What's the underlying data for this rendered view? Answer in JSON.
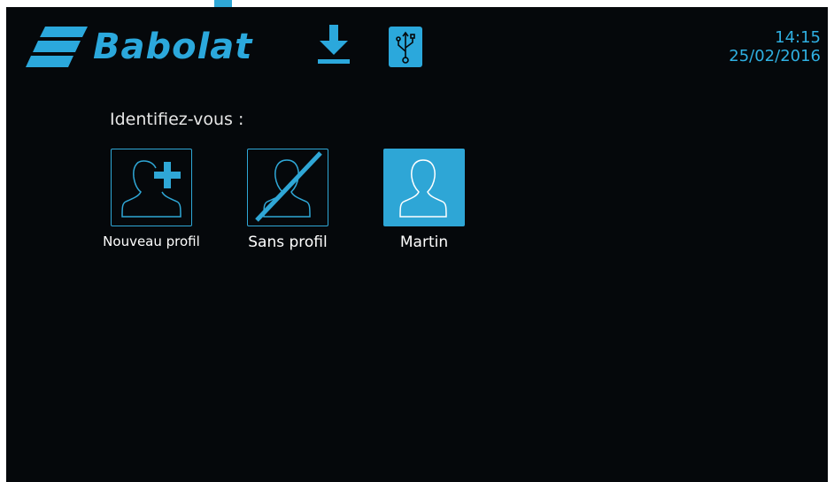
{
  "header": {
    "brand_name": "Babolat",
    "logo_icon": "babolat-stripes-logo",
    "download_icon": "download-icon",
    "usb_icon": "usb-icon",
    "accent_color": "#2ba8dc"
  },
  "clock": {
    "time": "14:15",
    "date": "25/02/2016"
  },
  "main": {
    "prompt": "Identifiez-vous :",
    "profiles": [
      {
        "label": "Nouveau profil",
        "icon": "add-user-icon",
        "selected": false
      },
      {
        "label": "Sans profil",
        "icon": "no-user-icon",
        "selected": false
      },
      {
        "label": "Martin",
        "icon": "user-icon",
        "selected": true
      }
    ]
  }
}
